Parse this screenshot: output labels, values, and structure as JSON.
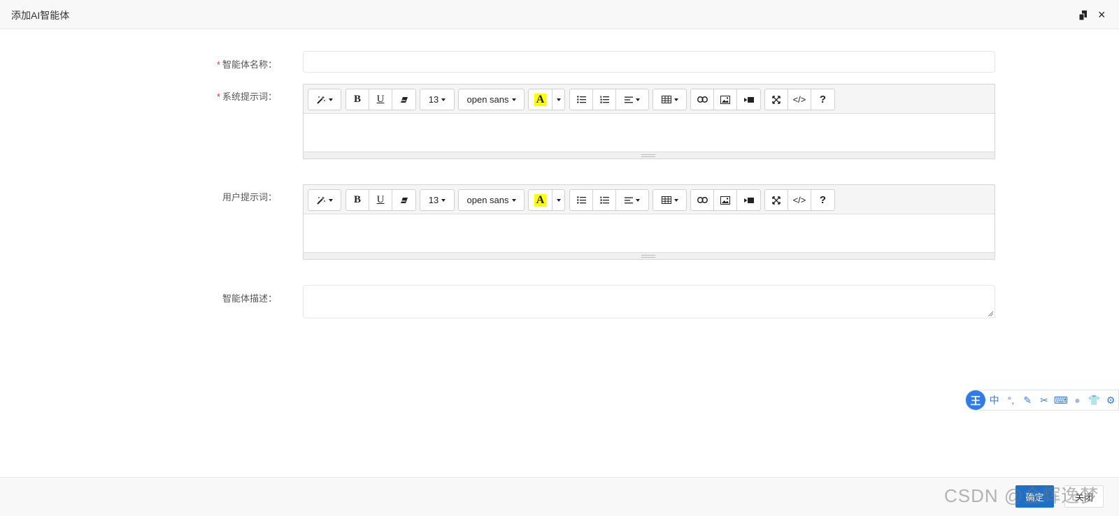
{
  "dialog": {
    "title": "添加AI智能体",
    "close_icon": "×"
  },
  "form": {
    "name": {
      "required_mark": "*",
      "label": "智能体名称：",
      "value": ""
    },
    "system_prompt": {
      "required_mark": "*",
      "label": "系统提示词："
    },
    "user_prompt": {
      "label": "用户提示词："
    },
    "description": {
      "label": "智能体描述：",
      "value": ""
    }
  },
  "editor_toolbar": {
    "font_size": "13",
    "font_family": "open sans",
    "highlight_letter": "A",
    "help": "?",
    "code_view": "</>",
    "icons": [
      "magic-icon",
      "bold-icon",
      "underline-icon",
      "eraser-icon",
      "font-size-dropdown",
      "font-family-dropdown",
      "highlight-color-icon",
      "unordered-list-icon",
      "ordered-list-icon",
      "align-icon",
      "table-icon",
      "link-icon",
      "picture-icon",
      "video-icon",
      "fullscreen-icon",
      "code-view-icon",
      "help-icon"
    ]
  },
  "footer": {
    "confirm_label": "确定",
    "close_label": "关闭"
  },
  "watermark": "CSDN @金辉逸梦",
  "ime_bar": {
    "logo": "王",
    "mode": "中",
    "punct": "°,"
  }
}
